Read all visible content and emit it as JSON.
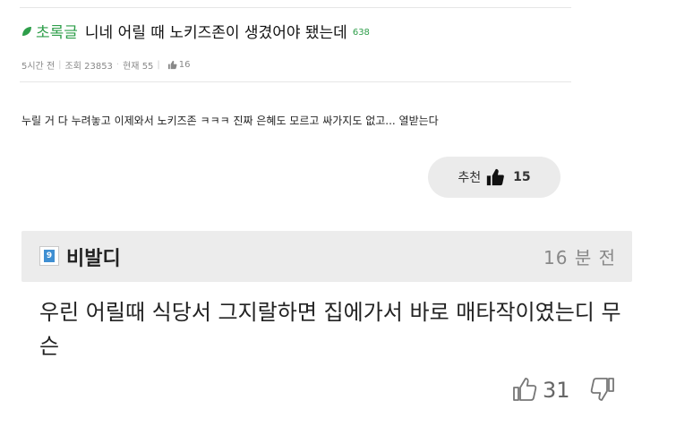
{
  "post": {
    "badge": "초록글",
    "title": "니네 어릴 때 노키즈존이 생겼어야 됐는데",
    "comment_count": "638",
    "meta": {
      "time": "5시간 전",
      "views": "조회 23853",
      "current": "현재 55",
      "likes": "16"
    },
    "body": "누릴 거 다 누려놓고 이제와서 노키즈존 ㅋㅋㅋ 진짜 은혜도 모르고 싸가지도 없고... 열받는다",
    "recommend": {
      "label": "추천",
      "count": "15"
    }
  },
  "comment": {
    "avatar_glyph": "9",
    "username": "비발디",
    "time": "16 분 전",
    "text": "우린 어릴때 식당서 그지랄하면 집에가서 바로 매타작이였는디 무슨",
    "likes": "31"
  },
  "colors": {
    "badge_green": "#2e9e4a",
    "comment_header_bg": "#ececec",
    "recommend_bg": "#ebebeb"
  }
}
